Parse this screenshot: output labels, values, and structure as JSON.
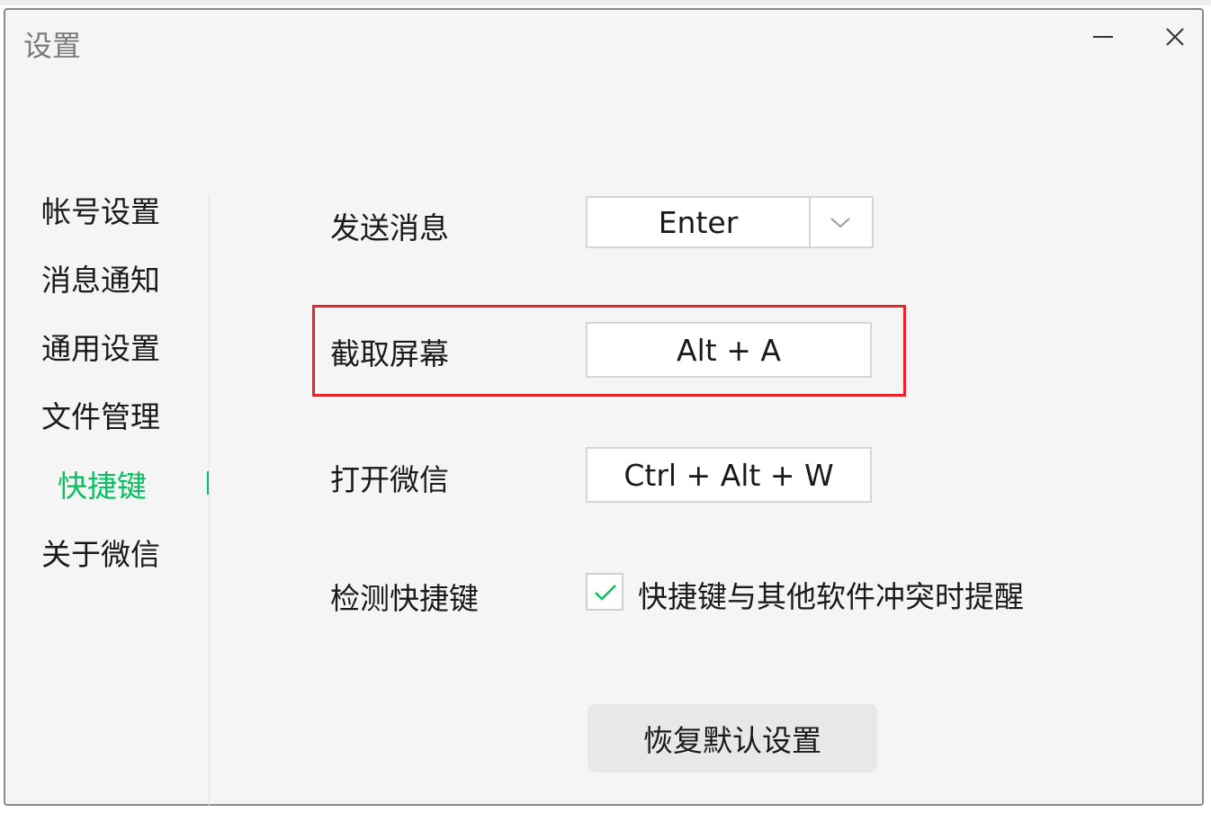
{
  "window": {
    "title": "设置",
    "minimize_icon": "minimize-icon",
    "close_icon": "close-icon"
  },
  "sidebar": {
    "items": [
      {
        "label": "帐号设置"
      },
      {
        "label": "消息通知"
      },
      {
        "label": "通用设置"
      },
      {
        "label": "文件管理"
      },
      {
        "label": "快捷键",
        "active": true
      },
      {
        "label": "关于微信"
      }
    ]
  },
  "shortcuts": {
    "send_message": {
      "label": "发送消息",
      "value": "Enter"
    },
    "screenshot": {
      "label": "截取屏幕",
      "value": "Alt + A"
    },
    "open_wechat": {
      "label": "打开微信",
      "value": "Ctrl + Alt + W"
    },
    "detect": {
      "label": "检测快捷键",
      "checkbox_label": "快捷键与其他软件冲突时提醒",
      "checked": true
    }
  },
  "restore_button": {
    "label": "恢复默认设置"
  },
  "colors": {
    "accent": "#07c160",
    "highlight": "#e8232b"
  }
}
